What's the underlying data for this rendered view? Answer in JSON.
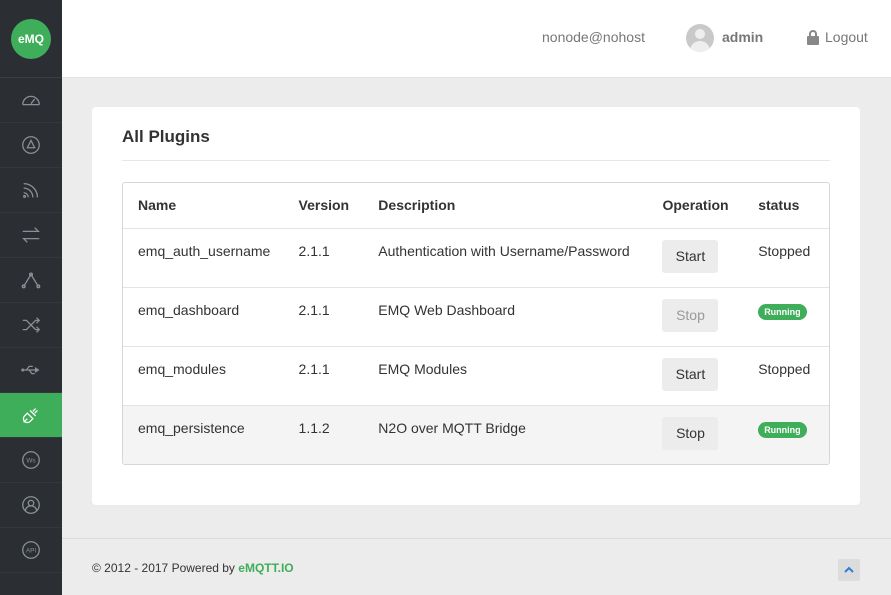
{
  "app": {
    "logo_text": "eMQ",
    "accent_color": "#3fae5a"
  },
  "sidebar": {
    "items": [
      {
        "icon": "dashboard-icon",
        "active": false
      },
      {
        "icon": "overview-icon",
        "active": false
      },
      {
        "icon": "rss-icon",
        "active": false
      },
      {
        "icon": "transfer-icon",
        "active": false
      },
      {
        "icon": "network-icon",
        "active": false
      },
      {
        "icon": "shuffle-icon",
        "active": false
      },
      {
        "icon": "usb-icon",
        "active": false
      },
      {
        "icon": "plug-icon",
        "active": true
      },
      {
        "icon": "websocket-icon",
        "active": false,
        "label": "Ws"
      },
      {
        "icon": "user-icon",
        "active": false
      },
      {
        "icon": "api-icon",
        "active": false,
        "label": "API"
      }
    ]
  },
  "header": {
    "node": "nonode@nohost",
    "user": "admin",
    "logout_label": "Logout"
  },
  "panel": {
    "title": "All Plugins",
    "columns": [
      "Name",
      "Version",
      "Description",
      "Operation",
      "status"
    ],
    "rows": [
      {
        "name": "emq_auth_username",
        "version": "2.1.1",
        "description": "Authentication with Username/Password",
        "operation": "Start",
        "status": "Stopped",
        "running": false
      },
      {
        "name": "emq_dashboard",
        "version": "2.1.1",
        "description": "EMQ Web Dashboard",
        "operation": "Stop",
        "status": "Running",
        "running": true,
        "disabled": true
      },
      {
        "name": "emq_modules",
        "version": "2.1.1",
        "description": "EMQ Modules",
        "operation": "Start",
        "status": "Stopped",
        "running": false
      },
      {
        "name": "emq_persistence",
        "version": "1.1.2",
        "description": "N2O over MQTT Bridge",
        "operation": "Stop",
        "status": "Running",
        "running": true
      }
    ]
  },
  "footer": {
    "copyright": "© 2012 - 2017 Powered by",
    "brand": "eMQTT.IO"
  }
}
